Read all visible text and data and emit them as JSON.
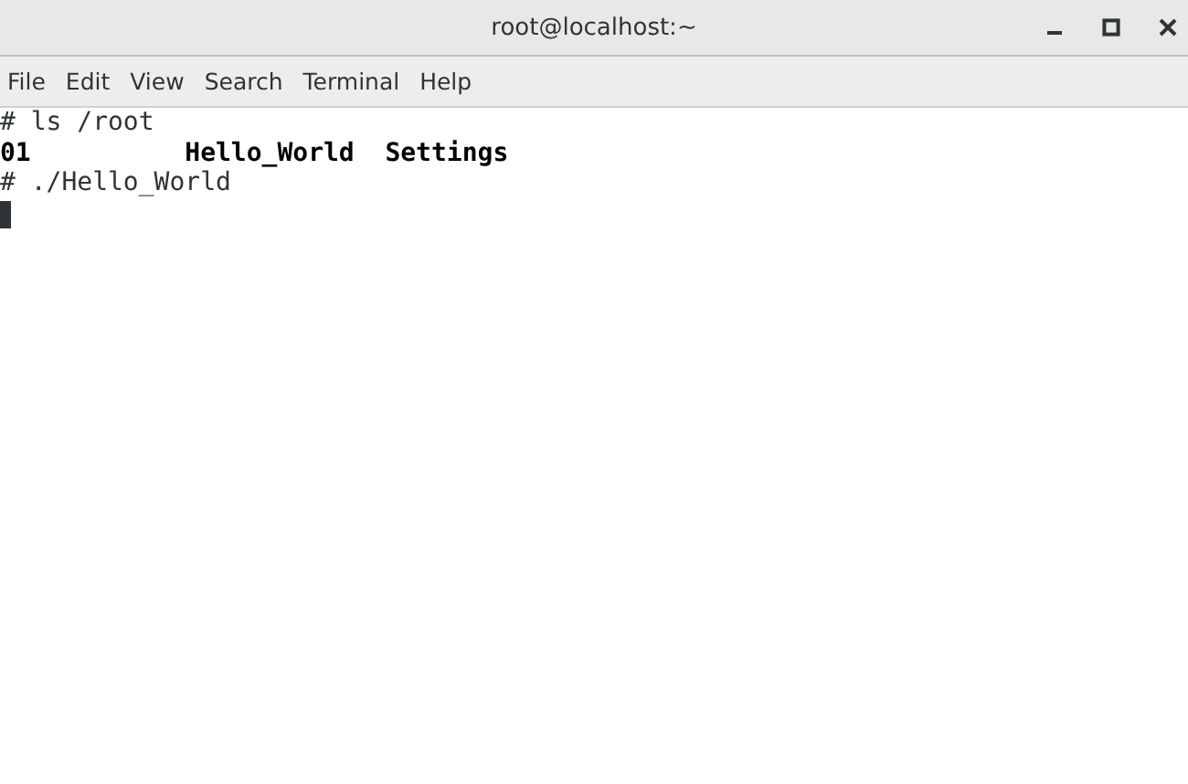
{
  "window": {
    "title": "root@localhost:~"
  },
  "menu": [
    "File",
    "Edit",
    "View",
    "Search",
    "Terminal",
    "Help"
  ],
  "lines": [
    {
      "kind": "text",
      "text": "# ls /root"
    },
    {
      "kind": "listing",
      "entries": [
        {
          "name": "01",
          "bold": true
        },
        {
          "name": "Hello_World",
          "bold": true
        },
        {
          "name": "Settings",
          "bold": true
        }
      ]
    },
    {
      "kind": "text",
      "text": "# ./Hello_World"
    },
    {
      "kind": "cursor"
    }
  ]
}
